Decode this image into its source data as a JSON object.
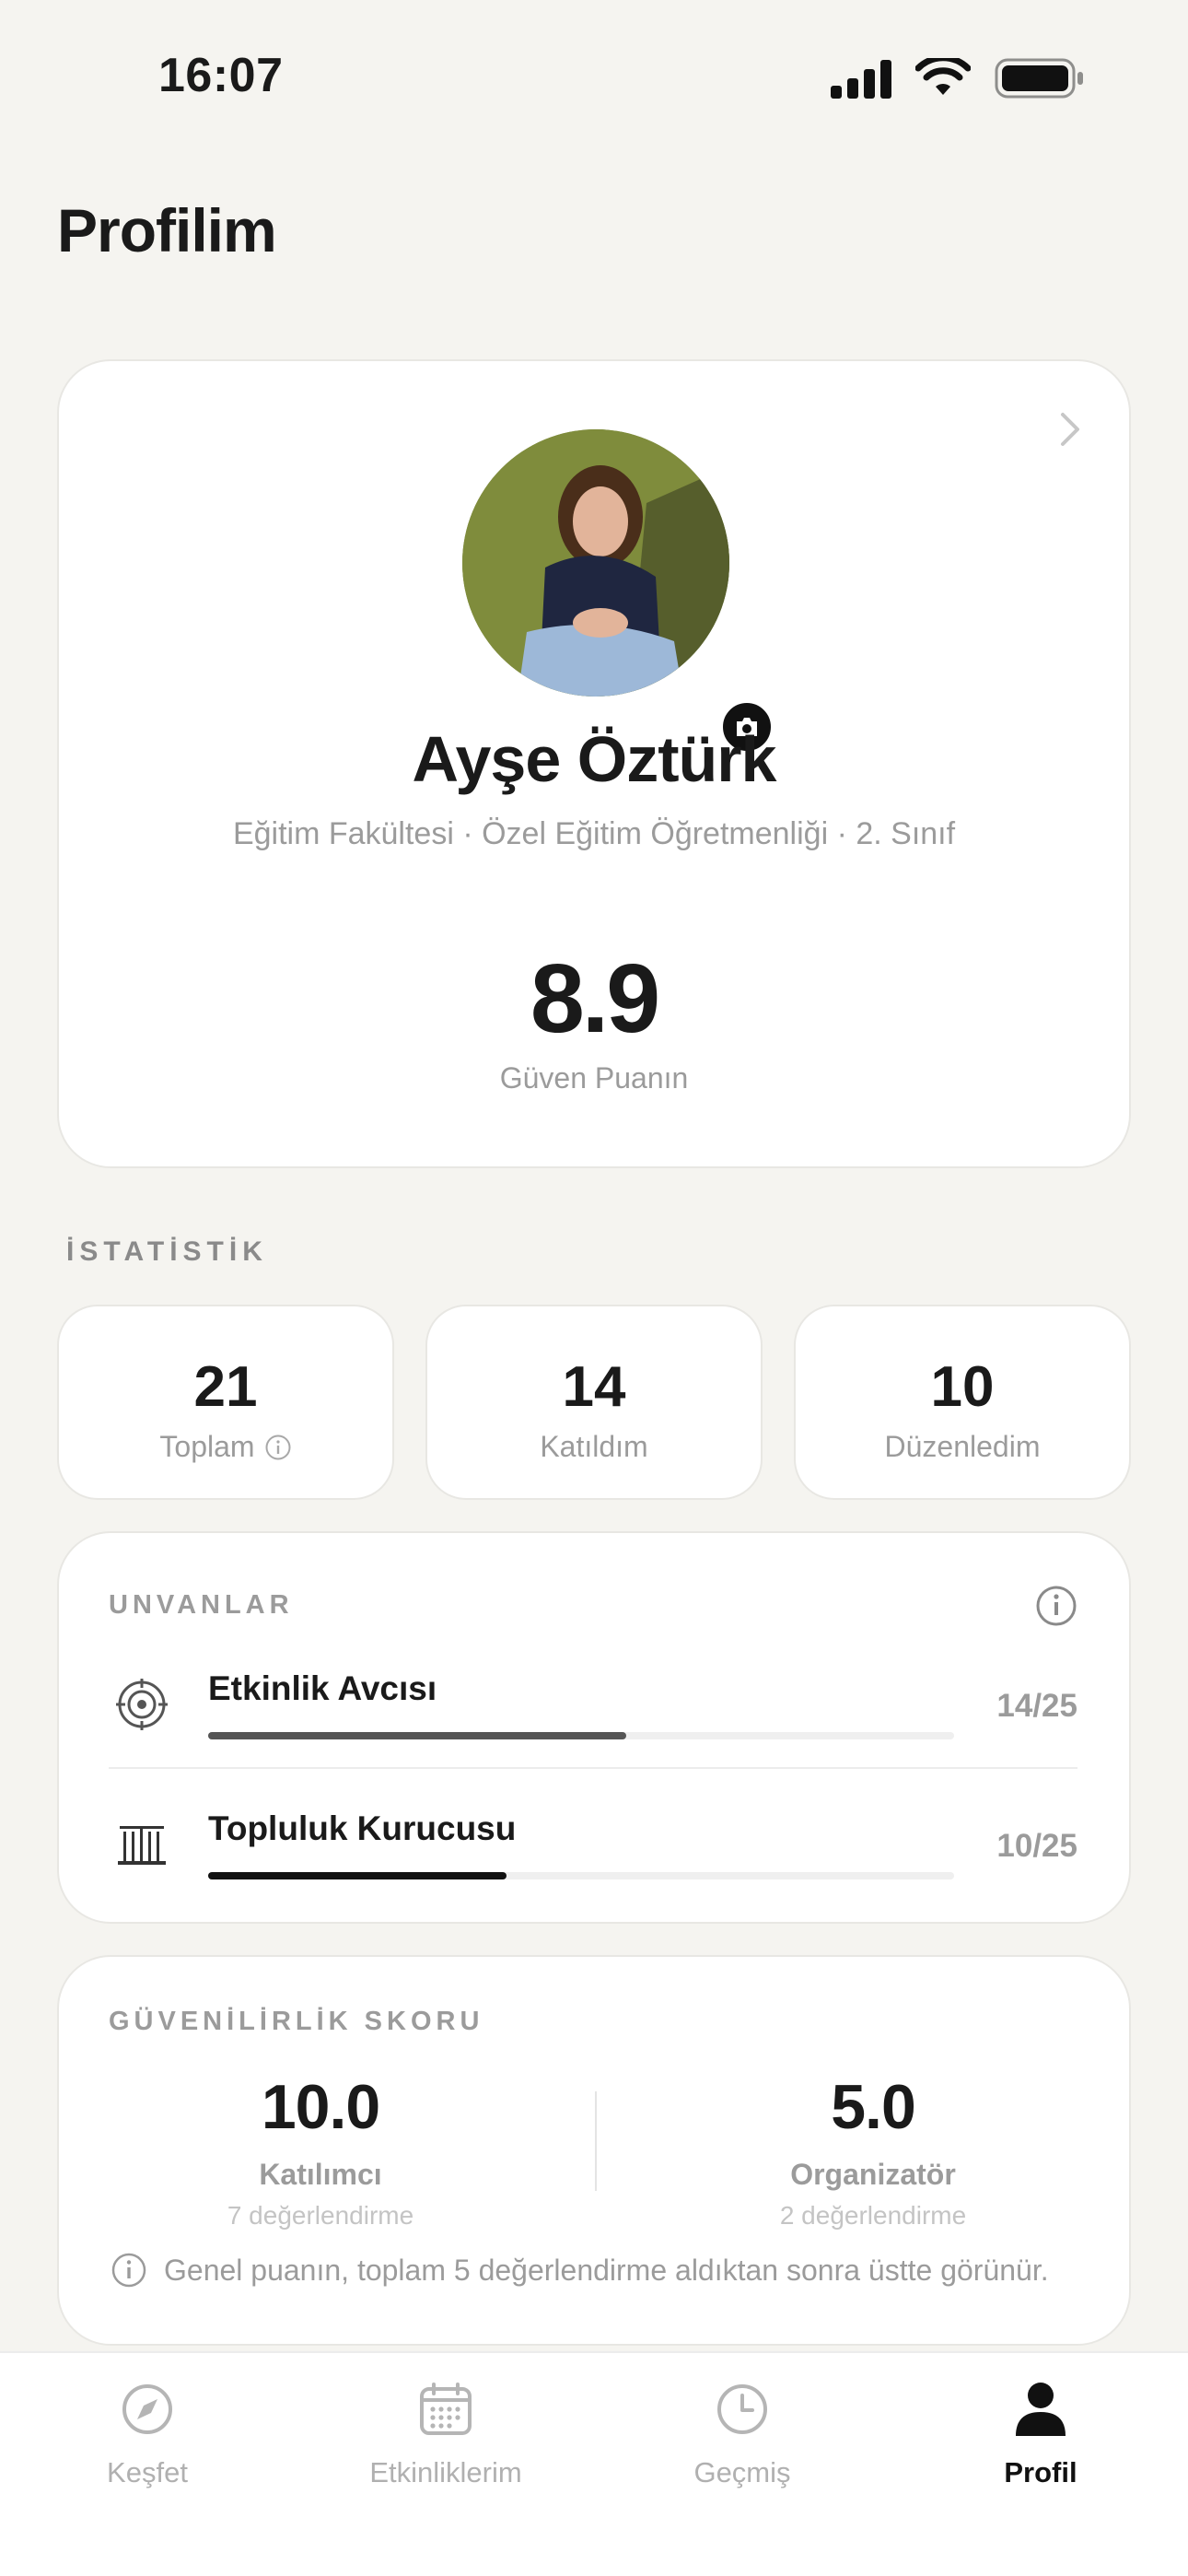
{
  "status_bar": {
    "time": "16:07"
  },
  "header": {
    "title": "Profilim"
  },
  "profile": {
    "name": "Ayşe Öztürk",
    "subtitle": "Eğitim Fakültesi · Özel Eğitim Öğretmenliği · 2. Sınıf",
    "trust_score": "8.9",
    "trust_score_label": "Güven Puanın"
  },
  "stats": {
    "section_label": "İSTATİSTİK",
    "items": [
      {
        "value": "21",
        "label": "Toplam"
      },
      {
        "value": "14",
        "label": "Katıldım"
      },
      {
        "value": "10",
        "label": "Düzenledim"
      }
    ]
  },
  "titles": {
    "section_label": "UNVANLAR",
    "items": [
      {
        "name": "Etkinlik Avcısı",
        "count": "14/25",
        "progress": 0.56,
        "color": "#555555",
        "icon": "target-icon"
      },
      {
        "name": "Topluluk Kurucusu",
        "count": "10/25",
        "progress": 0.4,
        "color": "#111111",
        "icon": "building-columns-icon"
      }
    ]
  },
  "reliability": {
    "section_label": "GÜVENİLİRLİK SKORU",
    "participant": {
      "value": "10.0",
      "label": "Katılımcı",
      "sub": "7 değerlendirme"
    },
    "organizer": {
      "value": "5.0",
      "label": "Organizatör",
      "sub": "2 değerlendirme"
    },
    "note": "Genel puanın, toplam 5 değerlendirme aldıktan sonra üstte görünür."
  },
  "tabbar": {
    "items": [
      {
        "label": "Keşfet",
        "icon": "compass-icon",
        "active": false
      },
      {
        "label": "Etkinliklerim",
        "icon": "calendar-icon",
        "active": false
      },
      {
        "label": "Geçmiş",
        "icon": "clock-icon",
        "active": false
      },
      {
        "label": "Profil",
        "icon": "person-icon",
        "active": true
      }
    ]
  }
}
